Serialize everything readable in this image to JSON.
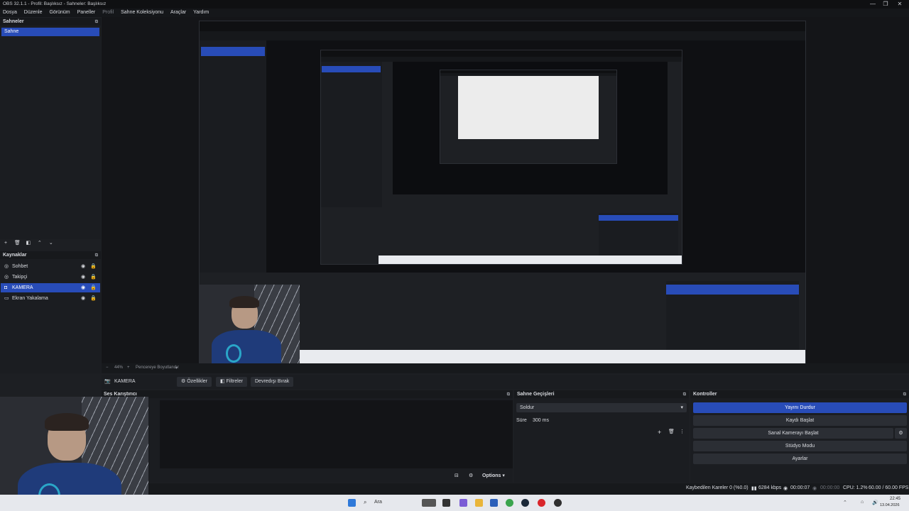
{
  "window": {
    "title": "OBS 32.1.1 - Profil: Başlıksız - Sahneler: Başlıksız",
    "controls": [
      "—",
      "❐",
      "✕"
    ]
  },
  "menu": [
    "Dosya",
    "Düzenle",
    "Görünüm",
    "Paneller",
    "Profil",
    "Sahne Koleksiyonu",
    "Araçlar",
    "Yardım"
  ],
  "scenes": {
    "title": "Sahneler",
    "items": [
      {
        "label": "Sahne",
        "selected": true
      }
    ]
  },
  "sources": {
    "title": "Kaynaklar",
    "items": [
      {
        "label": "Sohbet",
        "selected": false
      },
      {
        "label": "Takipçi",
        "selected": false
      },
      {
        "label": "KAMERA",
        "selected": true
      },
      {
        "label": "Ekran Yakalama",
        "selected": false
      }
    ]
  },
  "preview_bar": {
    "zoom": "44%",
    "mode": "Pencereye Boyutlandır"
  },
  "source_toolbar": {
    "selected_source": "KAMERA",
    "properties": "Özellikler",
    "filters": "Filtreler",
    "deactivate": "Devredışı Bırak"
  },
  "audio_mixer": {
    "title": "Ses Karıştırıcı",
    "options": "Options"
  },
  "transitions": {
    "title": "Sahne Geçişleri",
    "selected": "Soldur",
    "duration_label": "Süre",
    "duration_value": "300 ms"
  },
  "controls": {
    "title": "Kontroller",
    "buttons": [
      "Yayını Durdur",
      "Kaydı Başlat",
      "Sanal Kamerayı Başlat",
      "Stüdyo Modu",
      "Ayarlar"
    ]
  },
  "status": {
    "dropped": "Kaybedilen Kareler 0 (%0.0)",
    "bitrate": "6284 kbps",
    "stream_time": "00:00:07",
    "record_time": "00:00:00",
    "cpu": "CPU: 1.2%",
    "fps": "60.00 / 60.00 FPS"
  },
  "taskbar": {
    "search": "Ara",
    "time": "22:45",
    "date": "13.04.2026"
  },
  "colors": {
    "accent": "#284cb8",
    "bg": "#1d1f23",
    "panel": "#1b1d21"
  }
}
